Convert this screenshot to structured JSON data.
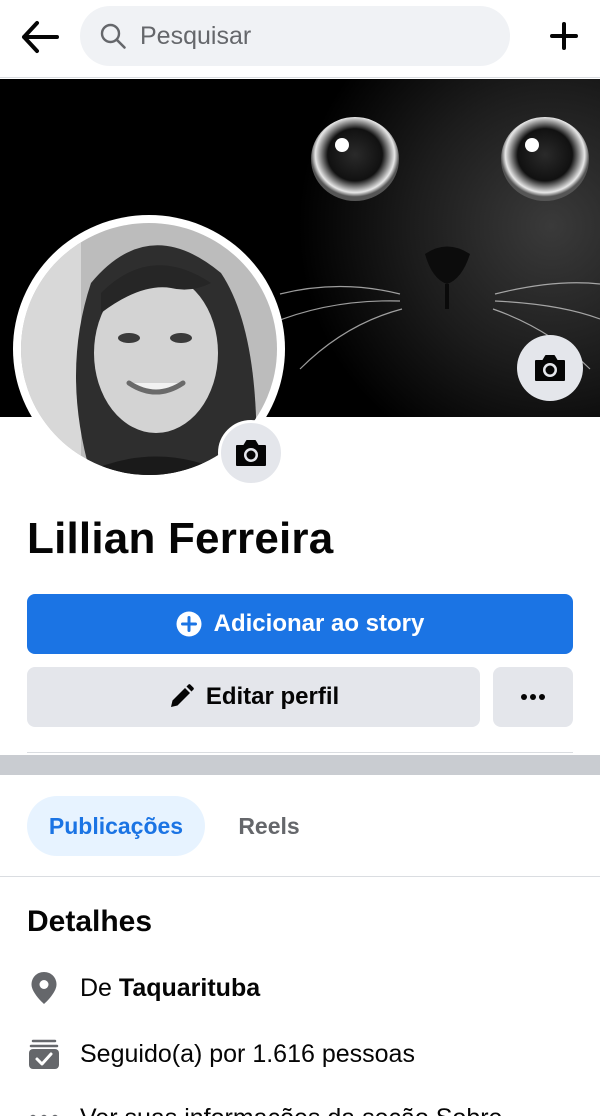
{
  "header": {
    "search_placeholder": "Pesquisar"
  },
  "profile": {
    "name": "Lillian Ferreira"
  },
  "actions": {
    "add_story_label": "Adicionar ao story",
    "edit_profile_label": "Editar perfil",
    "more_label": "•••"
  },
  "tabs": [
    {
      "label": "Publicações",
      "active": true
    },
    {
      "label": "Reels",
      "active": false
    }
  ],
  "details": {
    "title": "Detalhes",
    "hometown_prefix": "De",
    "hometown": "Taquarituba",
    "followers_text": "Seguido(a) por 1.616 pessoas",
    "about_text": "Ver suas informações da seção Sobre"
  },
  "colors": {
    "accent": "#1b74e4",
    "button_gray": "#e4e6eb",
    "tab_active_bg": "#e7f3ff",
    "text_secondary": "#65676b"
  },
  "icons": {
    "back": "arrow-left-icon",
    "search": "magnifier-icon",
    "create": "plus-icon",
    "camera": "camera-icon",
    "add": "plus-circle-icon",
    "edit": "pencil-icon",
    "location": "map-pin-icon",
    "followers": "rss-check-icon",
    "more": "ellipsis-icon"
  }
}
